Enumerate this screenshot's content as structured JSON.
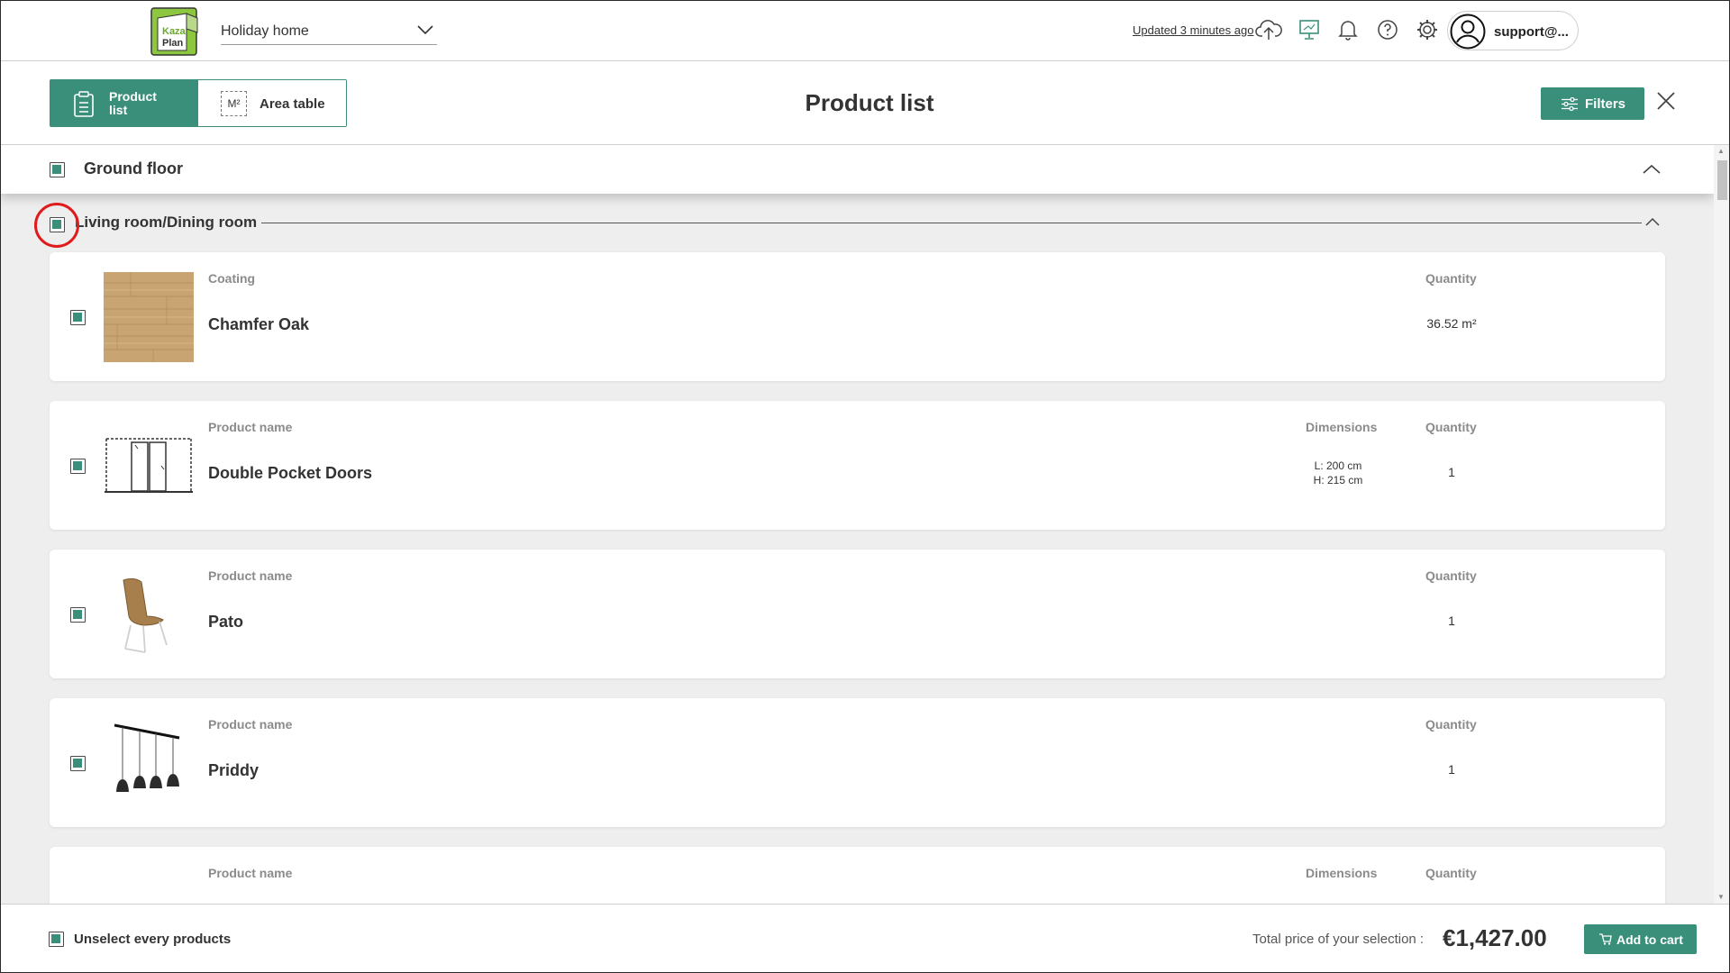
{
  "app": {
    "logo_text": "Kaza Plan"
  },
  "topbar": {
    "project": "Holiday home",
    "updated": "Updated 3 minutes ago",
    "user": "support@..."
  },
  "header": {
    "tab_product": "Product list",
    "tab_area": "Area table",
    "area_icon": "M²",
    "title": "Product list",
    "filters": "Filters"
  },
  "floor": {
    "label": "Ground floor"
  },
  "room": {
    "label": "Living room/Dining room"
  },
  "items": [
    {
      "label": "Coating",
      "name": "Chamfer Oak",
      "dimensions_label": "",
      "dimensions": [
        "",
        ""
      ],
      "quantity_label": "Quantity",
      "quantity": "36.52 m²"
    },
    {
      "label": "Product name",
      "name": "Double Pocket Doors",
      "dimensions_label": "Dimensions",
      "dimensions": [
        "L: 200 cm",
        "H: 215 cm"
      ],
      "quantity_label": "Quantity",
      "quantity": "1"
    },
    {
      "label": "Product name",
      "name": "Pato",
      "dimensions_label": "",
      "dimensions": [
        "",
        ""
      ],
      "quantity_label": "Quantity",
      "quantity": "1"
    },
    {
      "label": "Product name",
      "name": "Priddy",
      "dimensions_label": "",
      "dimensions": [
        "",
        ""
      ],
      "quantity_label": "Quantity",
      "quantity": "1"
    },
    {
      "label": "Product name",
      "name": "",
      "dimensions_label": "Dimensions",
      "dimensions": [
        "",
        ""
      ],
      "quantity_label": "Quantity",
      "quantity": ""
    }
  ],
  "footer": {
    "unselect": "Unselect every products",
    "total_label": "Total price of your selection :",
    "total": "€1,427.00",
    "add_to_cart": "Add to cart"
  },
  "colors": {
    "accent": "#3a8f7b",
    "highlight_ring": "#e01b1b",
    "background": "#eeeeee"
  }
}
